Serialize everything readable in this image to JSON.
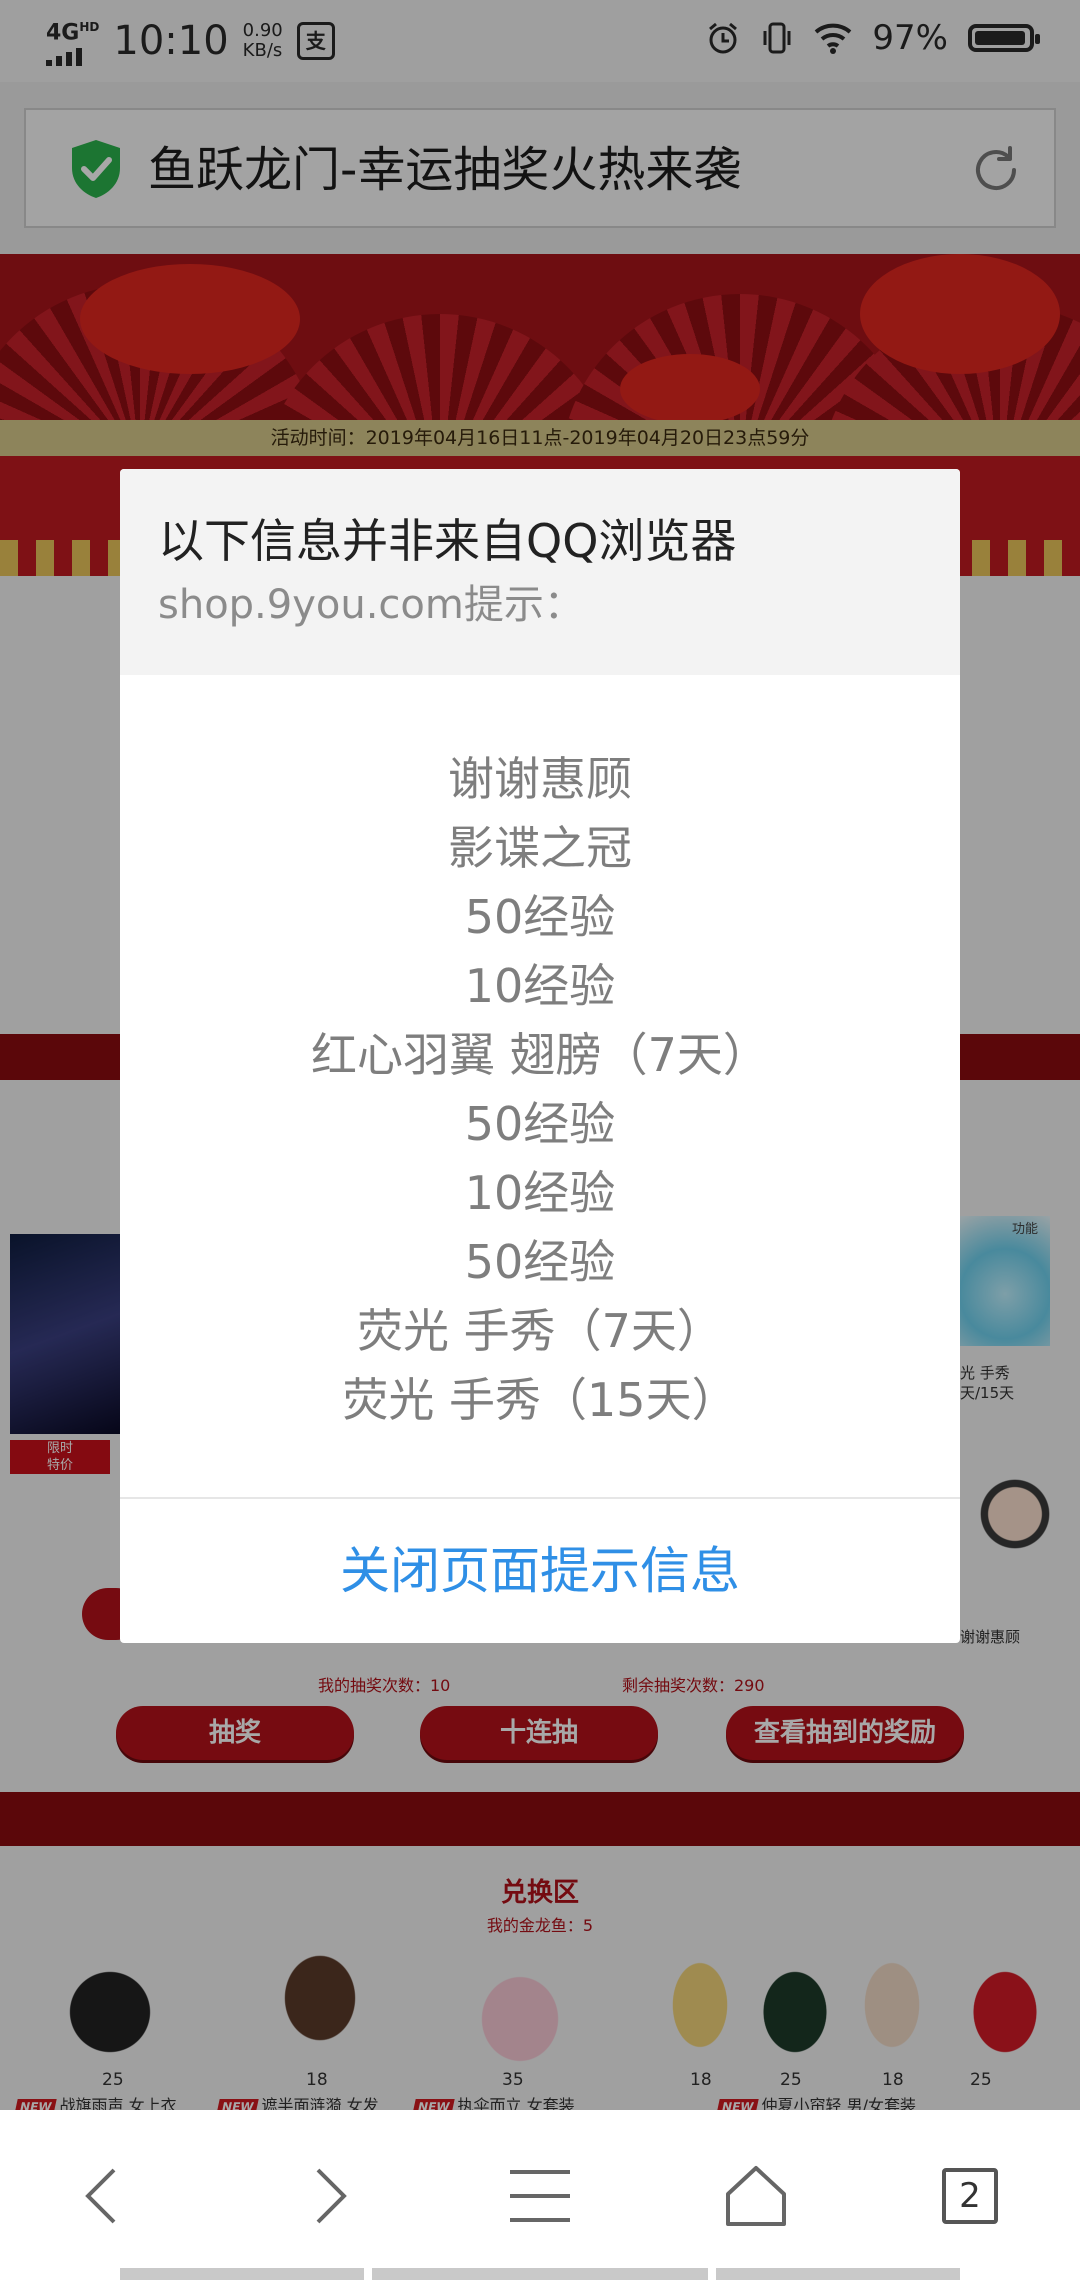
{
  "status_bar": {
    "network": "4G",
    "network_sup": "HD",
    "time": "10:10",
    "speed_value": "0.90",
    "speed_unit": "KB/s",
    "pay_icon_glyph": "支",
    "battery_percent": "97%",
    "battery_level": 0.97
  },
  "address_bar": {
    "title": "鱼跃龙门-幸运抽奖火热来袭",
    "security_icon": "shield-check-icon",
    "reload_icon": "reload-icon"
  },
  "webpage": {
    "activity_time": "活动时间：2019年04月16日11点-2019年04月20日23点59分",
    "my_draw_count": "我的抽奖次数：10",
    "remaining_draw_count": "剩余抽奖次数：290",
    "buttons": [
      "抽奖",
      "十连抽",
      "查看抽到的奖励"
    ],
    "side_labels": {
      "function_tag": "功能",
      "right_item_line1": "光 手秀",
      "right_item_line2": "天/15天",
      "right_bottom": "谢谢惠顾",
      "limited_badge": "限时\n特价",
      "new_badge": "NEW"
    },
    "exchange": {
      "title": "兑换区",
      "subtitle": "我的金龙鱼：5",
      "items": [
        {
          "price": "25",
          "name": "战旗雨声 女上衣"
        },
        {
          "price": "18",
          "name": "遮半面涟漪 女发"
        },
        {
          "price": "35",
          "name": "执伞而立 女套装"
        },
        {
          "price": "18",
          "name": ""
        },
        {
          "price": "25",
          "name": "仲夏小帘轻 男/女套装"
        },
        {
          "price": "18",
          "name": ""
        },
        {
          "price": "25",
          "name": ""
        }
      ],
      "new_tag": "NEW"
    }
  },
  "dialog": {
    "title": "以下信息并非来自QQ浏览器",
    "subtitle": "shop.9you.com提示：",
    "lines": [
      "谢谢惠顾",
      "影谍之冠",
      "50经验",
      "10经验",
      "红心羽翼 翅膀（7天）",
      "50经验",
      "10经验",
      "50经验",
      "荧光 手秀（7天）",
      "荧光 手秀（15天）"
    ],
    "close_button": "关闭页面提示信息"
  },
  "bottom_nav": {
    "back_icon": "chevron-left-icon",
    "forward_icon": "chevron-right-icon",
    "menu_icon": "menu-icon",
    "home_icon": "home-icon",
    "tab_count": "2"
  },
  "colors": {
    "accent_red": "#b3121a",
    "dialog_link": "#2f8fe6",
    "shield_green": "#2bb24c"
  }
}
